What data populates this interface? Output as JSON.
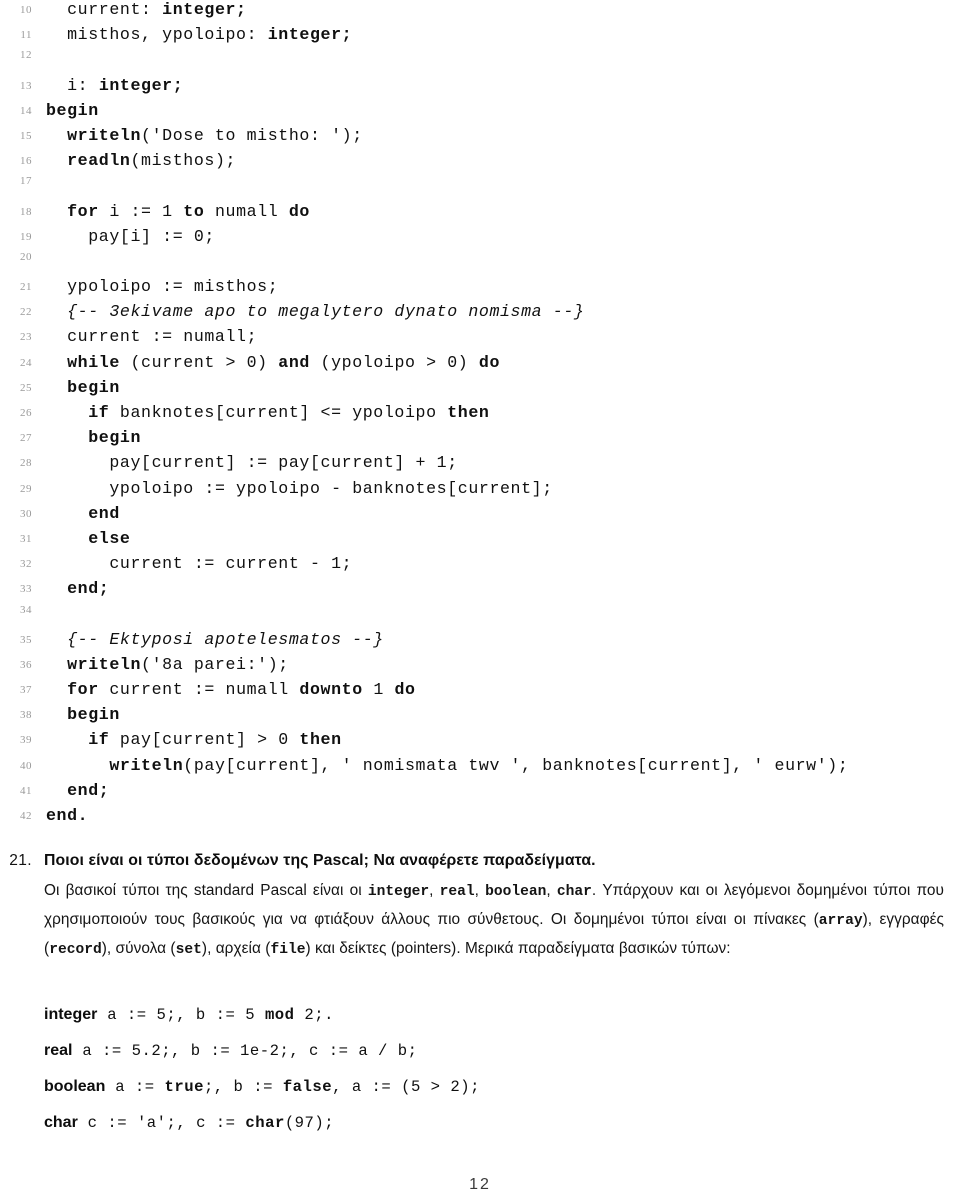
{
  "page": {
    "number": "12"
  },
  "listing": {
    "lines": [
      {
        "no": "10",
        "indent": 2,
        "segments": [
          {
            "t": "current: ",
            "s": "plain"
          },
          {
            "t": "integer;",
            "s": "kw"
          }
        ]
      },
      {
        "no": "11",
        "indent": 2,
        "segments": [
          {
            "t": "misthos, ypoloipo: ",
            "s": "plain"
          },
          {
            "t": "integer;",
            "s": "kw"
          }
        ]
      },
      {
        "no": "12",
        "indent": 0,
        "segments": []
      },
      {
        "no": "13",
        "indent": 2,
        "segments": [
          {
            "t": "i: ",
            "s": "plain"
          },
          {
            "t": "integer;",
            "s": "kw"
          }
        ]
      },
      {
        "no": "14",
        "indent": 0,
        "segments": [
          {
            "t": "begin",
            "s": "kw"
          }
        ]
      },
      {
        "no": "15",
        "indent": 2,
        "segments": [
          {
            "t": "writeln",
            "s": "kw"
          },
          {
            "t": "('Dose to mistho: ');",
            "s": "plain"
          }
        ]
      },
      {
        "no": "16",
        "indent": 2,
        "segments": [
          {
            "t": "readln",
            "s": "kw"
          },
          {
            "t": "(misthos);",
            "s": "plain"
          }
        ]
      },
      {
        "no": "17",
        "indent": 0,
        "segments": []
      },
      {
        "no": "18",
        "indent": 2,
        "segments": [
          {
            "t": "for",
            "s": "kw"
          },
          {
            "t": " i := 1 ",
            "s": "plain"
          },
          {
            "t": "to",
            "s": "kw"
          },
          {
            "t": " numall ",
            "s": "plain"
          },
          {
            "t": "do",
            "s": "kw"
          }
        ]
      },
      {
        "no": "19",
        "indent": 4,
        "segments": [
          {
            "t": "pay[i] := 0;",
            "s": "plain"
          }
        ]
      },
      {
        "no": "20",
        "indent": 0,
        "segments": []
      },
      {
        "no": "21",
        "indent": 2,
        "segments": [
          {
            "t": "ypoloipo := misthos;",
            "s": "plain"
          }
        ]
      },
      {
        "no": "22",
        "indent": 2,
        "segments": [
          {
            "t": "{-- 3ekivame apo to megalytero dynato nomisma --}",
            "s": "cmt"
          }
        ]
      },
      {
        "no": "23",
        "indent": 2,
        "segments": [
          {
            "t": "current := numall;",
            "s": "plain"
          }
        ]
      },
      {
        "no": "24",
        "indent": 2,
        "segments": [
          {
            "t": "while",
            "s": "kw"
          },
          {
            "t": " (current > 0) ",
            "s": "plain"
          },
          {
            "t": "and",
            "s": "kw"
          },
          {
            "t": " (ypoloipo > 0) ",
            "s": "plain"
          },
          {
            "t": "do",
            "s": "kw"
          }
        ]
      },
      {
        "no": "25",
        "indent": 2,
        "segments": [
          {
            "t": "begin",
            "s": "kw"
          }
        ]
      },
      {
        "no": "26",
        "indent": 4,
        "segments": [
          {
            "t": "if",
            "s": "kw"
          },
          {
            "t": " banknotes[current] <= ypoloipo ",
            "s": "plain"
          },
          {
            "t": "then",
            "s": "kw"
          }
        ]
      },
      {
        "no": "27",
        "indent": 4,
        "segments": [
          {
            "t": "begin",
            "s": "kw"
          }
        ]
      },
      {
        "no": "28",
        "indent": 6,
        "segments": [
          {
            "t": "pay[current] := pay[current] + 1;",
            "s": "plain"
          }
        ]
      },
      {
        "no": "29",
        "indent": 6,
        "segments": [
          {
            "t": "ypoloipo := ypoloipo - banknotes[current];",
            "s": "plain"
          }
        ]
      },
      {
        "no": "30",
        "indent": 4,
        "segments": [
          {
            "t": "end",
            "s": "kw"
          }
        ]
      },
      {
        "no": "31",
        "indent": 4,
        "segments": [
          {
            "t": "else",
            "s": "kw"
          }
        ]
      },
      {
        "no": "32",
        "indent": 6,
        "segments": [
          {
            "t": "current := current - 1;",
            "s": "plain"
          }
        ]
      },
      {
        "no": "33",
        "indent": 2,
        "segments": [
          {
            "t": "end;",
            "s": "kw"
          }
        ]
      },
      {
        "no": "34",
        "indent": 0,
        "segments": []
      },
      {
        "no": "35",
        "indent": 2,
        "segments": [
          {
            "t": "{-- Ektyposi apotelesmatos --}",
            "s": "cmt"
          }
        ]
      },
      {
        "no": "36",
        "indent": 2,
        "segments": [
          {
            "t": "writeln",
            "s": "kw"
          },
          {
            "t": "('8a parei:');",
            "s": "plain"
          }
        ]
      },
      {
        "no": "37",
        "indent": 2,
        "segments": [
          {
            "t": "for",
            "s": "kw"
          },
          {
            "t": " current := numall ",
            "s": "plain"
          },
          {
            "t": "downto",
            "s": "kw"
          },
          {
            "t": " 1 ",
            "s": "plain"
          },
          {
            "t": "do",
            "s": "kw"
          }
        ]
      },
      {
        "no": "38",
        "indent": 2,
        "segments": [
          {
            "t": "begin",
            "s": "kw"
          }
        ]
      },
      {
        "no": "39",
        "indent": 4,
        "segments": [
          {
            "t": "if",
            "s": "kw"
          },
          {
            "t": " pay[current] > 0 ",
            "s": "plain"
          },
          {
            "t": "then",
            "s": "kw"
          }
        ]
      },
      {
        "no": "40",
        "indent": 6,
        "segments": [
          {
            "t": "writeln",
            "s": "kw"
          },
          {
            "t": "(pay[current], ' nomismata twv ', banknotes[current], ' eurw');",
            "s": "plain"
          }
        ]
      },
      {
        "no": "41",
        "indent": 2,
        "segments": [
          {
            "t": "end;",
            "s": "kw"
          }
        ]
      },
      {
        "no": "42",
        "indent": 0,
        "segments": [
          {
            "t": "end.",
            "s": "kw"
          }
        ]
      }
    ]
  },
  "question": {
    "number": "21.",
    "title": "Ποιοι είναι οι τύποι δεδομένων της Pascal; Να αναφέρετε παραδείγματα.",
    "paragraph": [
      {
        "t": "Οι βασικοί τύποι της standard Pascal είναι οι ",
        "s": "plain"
      },
      {
        "t": "integer",
        "s": "mono"
      },
      {
        "t": ", ",
        "s": "plain"
      },
      {
        "t": "real",
        "s": "mono"
      },
      {
        "t": ", ",
        "s": "plain"
      },
      {
        "t": "boolean",
        "s": "mono"
      },
      {
        "t": ", ",
        "s": "plain"
      },
      {
        "t": "char",
        "s": "mono"
      },
      {
        "t": ". Υπάρχουν και οι λεγόμενοι δομημένοι τύποι που χρησιμοποιούν τους βασικούς για να φτιάξουν άλλους πιο σύνθετους. Οι δομημένοι τύποι είναι οι πίνακες (",
        "s": "plain"
      },
      {
        "t": "array",
        "s": "mono"
      },
      {
        "t": "), εγγραφές (",
        "s": "plain"
      },
      {
        "t": "record",
        "s": "mono"
      },
      {
        "t": "), σύνολα (",
        "s": "plain"
      },
      {
        "t": "set",
        "s": "mono"
      },
      {
        "t": "), αρχεία (",
        "s": "plain"
      },
      {
        "t": "file",
        "s": "mono"
      },
      {
        "t": ") και δείκτες (pointers). Μερικά παραδείγματα βασικών τύπων:",
        "s": "plain"
      }
    ]
  },
  "examples": [
    {
      "keyword": "integer",
      "segments": [
        {
          "t": " a := 5;, b := 5 ",
          "s": "plain"
        },
        {
          "t": "mod",
          "s": "bold"
        },
        {
          "t": " 2;.",
          "s": "plain"
        }
      ]
    },
    {
      "keyword": "real",
      "segments": [
        {
          "t": " a := 5.2;, b := 1e-2;, c := a / b;",
          "s": "plain"
        }
      ]
    },
    {
      "keyword": "boolean",
      "segments": [
        {
          "t": " a := ",
          "s": "plain"
        },
        {
          "t": "true",
          "s": "bold"
        },
        {
          "t": ";, b := ",
          "s": "plain"
        },
        {
          "t": "false",
          "s": "bold"
        },
        {
          "t": ", a := (5 > 2);",
          "s": "plain"
        }
      ]
    },
    {
      "keyword": "char",
      "segments": [
        {
          "t": " c := 'a';, c := ",
          "s": "plain"
        },
        {
          "t": "char",
          "s": "bold"
        },
        {
          "t": "(97);",
          "s": "plain"
        }
      ]
    }
  ]
}
